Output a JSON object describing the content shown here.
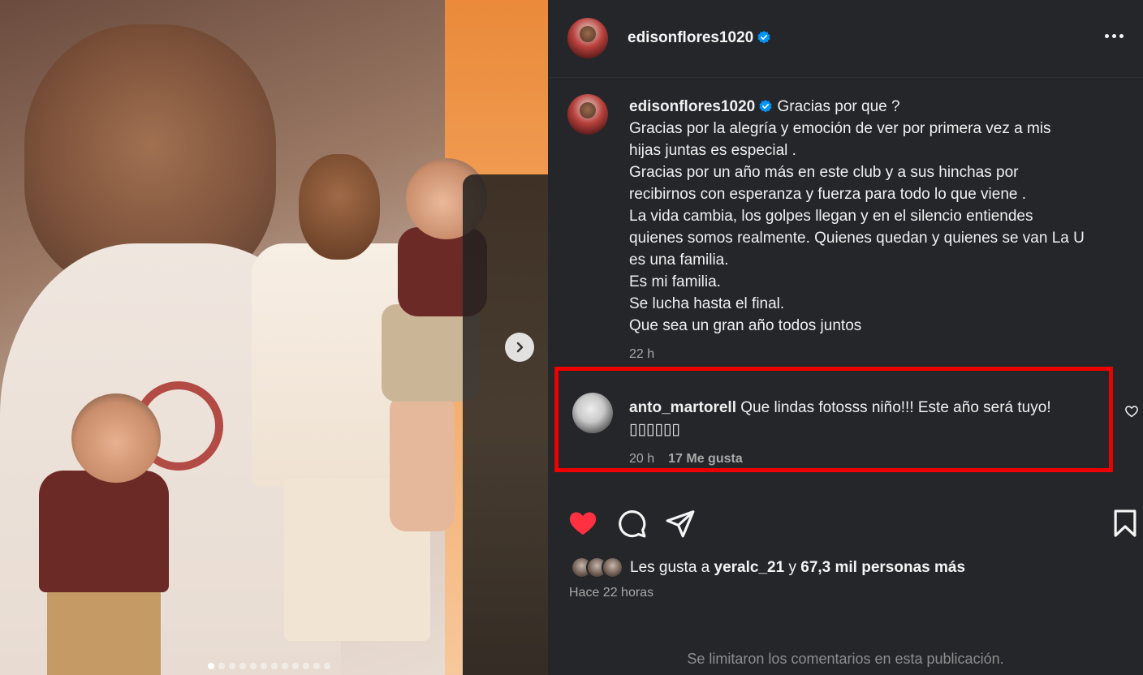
{
  "post": {
    "author": "edisonflores1020",
    "carousel": {
      "dot_count": 12,
      "active_index": 0
    }
  },
  "caption": {
    "username": "edisonflores1020",
    "first_line": "Gracias por que ?",
    "lines": [
      "Gracias por la alegría y emoción de ver por primera vez a mis",
      "hijas juntas es especial .",
      "Gracias por un año más en este club y a sus hinchas por",
      "recibirnos con esperanza y fuerza para todo lo que viene .",
      "La vida cambia, los golpes llegan y en el silencio entiendes",
      "quienes somos realmente. Quienes quedan y quienes se van La U",
      "es una familia.",
      "Es mi familia.",
      "Se lucha hasta el final.",
      "Que sea un gran año todos juntos"
    ],
    "time": "22 h"
  },
  "comment": {
    "username": "anto_martorell",
    "text": "Que lindas fotosss niño!!! Este año será tuyo!",
    "emoji_line": "▯▯▯▯▯▯",
    "time": "20 h",
    "likes": "17 Me gusta",
    "highlight_color": "#ec0000"
  },
  "likes": {
    "prefix": "Les gusta a",
    "first_user": "yeralc_21",
    "joiner": "y",
    "others": "67,3 mil personas más"
  },
  "posted": "Hace 22 horas",
  "comments_limited": "Se limitaron los comentarios en esta publicación.",
  "colors": {
    "panel_bg": "#25262a",
    "like_red": "#ff3040",
    "verified_blue": "#0095f6",
    "muted_text": "#a8a8a8"
  },
  "icons": {
    "verified": "verified-badge-icon",
    "more": "more-options-icon",
    "next": "chevron-right-icon",
    "like": "heart-filled-icon",
    "comment": "comment-icon",
    "share": "share-icon",
    "save": "bookmark-icon",
    "comment_like": "heart-outline-icon"
  }
}
